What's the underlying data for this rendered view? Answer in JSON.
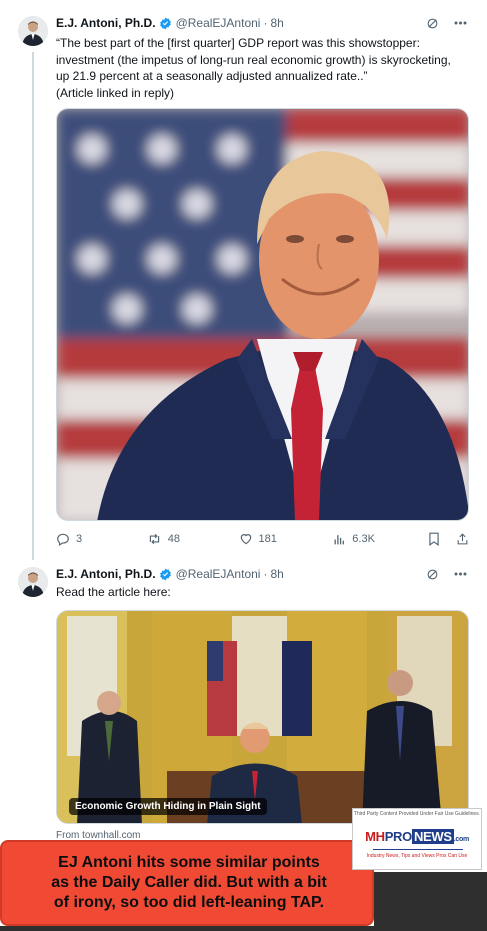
{
  "tweet1": {
    "author_name": "E.J. Antoni, Ph.D.",
    "handle": "@RealEJAntoni",
    "time": "8h",
    "text_lines": [
      "“The best part of the [first quarter] GDP report was this showstopper:",
      "investment (the impetus of long-run real economic growth) is skyrocketing,",
      "up 21.9 percent at a seasonally adjusted annualized rate..”",
      "(Article linked in reply)"
    ],
    "image_desc": "portrait-with-flag",
    "stats": {
      "replies": "3",
      "reposts": "48",
      "likes": "181",
      "views": "6.3K"
    }
  },
  "tweet2": {
    "author_name": "E.J. Antoni, Ph.D.",
    "handle": "@RealEJAntoni",
    "time": "8h",
    "text": "Read the article here:",
    "card_caption": "Economic Growth Hiding in Plain Sight",
    "card_source": "From townhall.com"
  },
  "callout": {
    "lines": [
      "EJ Antoni hits some similar points",
      "as the Daily Caller did. But with a bit",
      "of irony, so too did left-leaning TAP."
    ],
    "color": "#f04a35"
  },
  "badge": {
    "fair_use": "Third Party Content Provided Under Fair Use Guidelines.",
    "logo_mh": "MH",
    "logo_pro": "PRO",
    "logo_news": "NEWS",
    "logo_com": ".com",
    "tagline": "Industry News, Tips and Views Pros Can Use"
  },
  "colors": {
    "verified": "#1d9bf0",
    "muted": "#536471",
    "border": "#cfd9de"
  },
  "icons": [
    "verified-icon",
    "grok-icon",
    "more-icon",
    "reply-icon",
    "repost-icon",
    "like-icon",
    "views-icon",
    "bookmark-icon",
    "share-icon"
  ]
}
